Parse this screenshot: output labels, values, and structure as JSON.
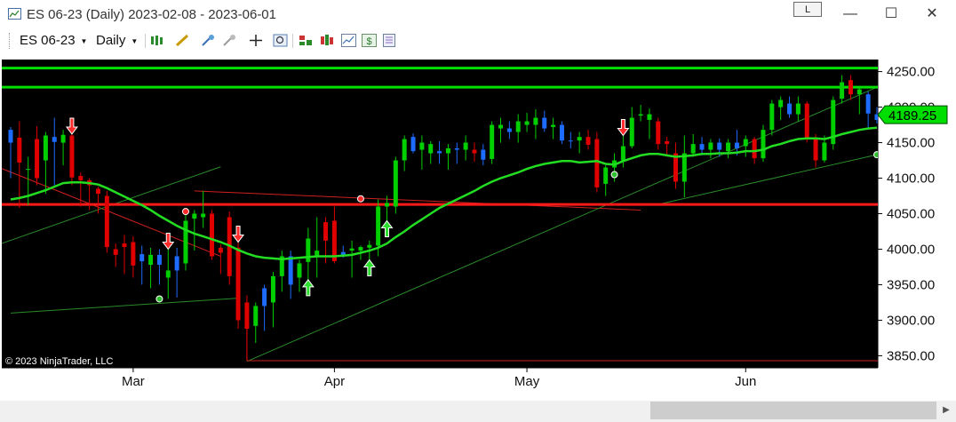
{
  "window": {
    "title": "ES 06-23 (Daily)  2023-02-08 - 2023-06-01",
    "link_button": "L",
    "minimize": "—",
    "maximize": "☐",
    "close": "✕"
  },
  "toolbar": {
    "instrument": "ES 06-23",
    "interval": "Daily",
    "icons": [
      "bar-style-icon",
      "drawing-tool-icon",
      "add-indicator-icon",
      "remove-indicator-icon",
      "crosshair-icon",
      "zoom-icon",
      "strategies-icon",
      "chart-trader-icon",
      "data-series-icon",
      "properties-icon"
    ]
  },
  "colors": {
    "background": "#000000",
    "up_candle": "#00d000",
    "down_candle": "#e00000",
    "blue_candle": "#1e6bff",
    "sma": "#22dd22",
    "horizontal_support": "#ff1a1a",
    "horizontal_resistance": "#00e000",
    "trend_green": "#2a8a2a",
    "trend_red": "#d02020",
    "price_marker": "#00dd00"
  },
  "chart_data": {
    "type": "candlestick",
    "instrument": "ES 06-23",
    "interval": "Daily",
    "x_range": [
      "2023-02-08",
      "2023-06-01"
    ],
    "x_tick_labels": [
      "Mar",
      "Apr",
      "May",
      "Jun"
    ],
    "y_tick_labels": [
      "4250.00",
      "4200.00",
      "4150.00",
      "4100.00",
      "4050.00",
      "4000.00",
      "3950.00",
      "3900.00",
      "3850.00"
    ],
    "ylim": [
      3833,
      4267
    ],
    "last_price": "4189.25",
    "copyright": "© 2023 NinjaTrader, LLC",
    "horizontal_lines": [
      {
        "price": 4255,
        "color": "green"
      },
      {
        "price": 4228,
        "color": "green"
      },
      {
        "price": 4063,
        "color": "red"
      }
    ],
    "candles": [
      {
        "o": 4150,
        "h": 4172,
        "l": 4100,
        "c": 4168,
        "k": "b"
      },
      {
        "o": 4157,
        "h": 4180,
        "l": 4058,
        "c": 4122,
        "k": "d"
      },
      {
        "o": 4113,
        "h": 4130,
        "l": 4062,
        "c": 4113,
        "k": "u"
      },
      {
        "o": 4100,
        "h": 4173,
        "l": 4090,
        "c": 4155,
        "k": "d"
      },
      {
        "o": 4125,
        "h": 4165,
        "l": 4078,
        "c": 4160,
        "k": "u"
      },
      {
        "o": 4158,
        "h": 4185,
        "l": 4090,
        "c": 4151,
        "k": "b"
      },
      {
        "o": 4150,
        "h": 4168,
        "l": 4118,
        "c": 4161,
        "k": "u"
      },
      {
        "o": 4160,
        "h": 4162,
        "l": 4090,
        "c": 4101,
        "k": "d"
      },
      {
        "o": 4103,
        "h": 4108,
        "l": 4060,
        "c": 4097,
        "k": "d"
      },
      {
        "o": 4097,
        "h": 4100,
        "l": 4055,
        "c": 4090,
        "k": "d"
      },
      {
        "o": 4085,
        "h": 4088,
        "l": 4050,
        "c": 4078,
        "k": "d"
      },
      {
        "o": 4075,
        "h": 4082,
        "l": 3995,
        "c": 4003,
        "k": "d"
      },
      {
        "o": 4000,
        "h": 4008,
        "l": 3975,
        "c": 3992,
        "k": "d"
      },
      {
        "o": 4008,
        "h": 4020,
        "l": 3965,
        "c": 4003,
        "k": "d"
      },
      {
        "o": 4010,
        "h": 4018,
        "l": 3960,
        "c": 3977,
        "k": "d"
      },
      {
        "o": 3983,
        "h": 4005,
        "l": 3950,
        "c": 3993,
        "k": "b"
      },
      {
        "o": 3978,
        "h": 4002,
        "l": 3945,
        "c": 3992,
        "k": "u"
      },
      {
        "o": 3992,
        "h": 4000,
        "l": 3950,
        "c": 3978,
        "k": "b"
      },
      {
        "o": 3970,
        "h": 4000,
        "l": 3930,
        "c": 3960,
        "k": "u"
      },
      {
        "o": 3970,
        "h": 4002,
        "l": 3932,
        "c": 3990,
        "k": "b"
      },
      {
        "o": 3980,
        "h": 4052,
        "l": 3970,
        "c": 4040,
        "k": "u"
      },
      {
        "o": 4043,
        "h": 4055,
        "l": 3998,
        "c": 4050,
        "k": "u"
      },
      {
        "o": 4045,
        "h": 4082,
        "l": 4030,
        "c": 4050,
        "k": "u"
      },
      {
        "o": 4050,
        "h": 4055,
        "l": 3985,
        "c": 3990,
        "k": "d"
      },
      {
        "o": 4002,
        "h": 4007,
        "l": 3965,
        "c": 3995,
        "k": "d"
      },
      {
        "o": 4045,
        "h": 4053,
        "l": 3950,
        "c": 3962,
        "k": "d"
      },
      {
        "o": 4002,
        "h": 4010,
        "l": 3888,
        "c": 3900,
        "k": "d"
      },
      {
        "o": 3925,
        "h": 3935,
        "l": 3843,
        "c": 3888,
        "k": "d"
      },
      {
        "o": 3892,
        "h": 3925,
        "l": 3868,
        "c": 3920,
        "k": "u"
      },
      {
        "o": 3920,
        "h": 3950,
        "l": 3885,
        "c": 3945,
        "k": "b"
      },
      {
        "o": 3925,
        "h": 3968,
        "l": 3890,
        "c": 3962,
        "k": "u"
      },
      {
        "o": 3962,
        "h": 3998,
        "l": 3940,
        "c": 3990,
        "k": "u"
      },
      {
        "o": 3990,
        "h": 3998,
        "l": 3930,
        "c": 3950,
        "k": "b"
      },
      {
        "o": 3960,
        "h": 3985,
        "l": 3940,
        "c": 3980,
        "k": "u"
      },
      {
        "o": 3982,
        "h": 4030,
        "l": 3957,
        "c": 4015,
        "k": "u"
      },
      {
        "o": 3990,
        "h": 4045,
        "l": 3960,
        "c": 3998,
        "k": "u"
      },
      {
        "o": 4038,
        "h": 4045,
        "l": 3980,
        "c": 4012,
        "k": "d"
      },
      {
        "o": 4040,
        "h": 4060,
        "l": 3980,
        "c": 3983,
        "k": "d"
      },
      {
        "o": 3992,
        "h": 4005,
        "l": 3988,
        "c": 3996,
        "k": "b"
      },
      {
        "o": 3998,
        "h": 4012,
        "l": 3960,
        "c": 4001,
        "k": "u"
      },
      {
        "o": 3998,
        "h": 4005,
        "l": 3985,
        "c": 4003,
        "k": "u"
      },
      {
        "o": 4002,
        "h": 4012,
        "l": 3985,
        "c": 4006,
        "k": "u"
      },
      {
        "o": 4005,
        "h": 4070,
        "l": 3990,
        "c": 4060,
        "k": "u"
      },
      {
        "o": 4060,
        "h": 4075,
        "l": 4040,
        "c": 4065,
        "k": "u"
      },
      {
        "o": 4060,
        "h": 4130,
        "l": 4050,
        "c": 4125,
        "k": "u"
      },
      {
        "o": 4125,
        "h": 4160,
        "l": 4110,
        "c": 4155,
        "k": "u"
      },
      {
        "o": 4158,
        "h": 4163,
        "l": 4135,
        "c": 4138,
        "k": "b"
      },
      {
        "o": 4140,
        "h": 4160,
        "l": 4112,
        "c": 4150,
        "k": "u"
      },
      {
        "o": 4148,
        "h": 4152,
        "l": 4120,
        "c": 4135,
        "k": "u"
      },
      {
        "o": 4138,
        "h": 4152,
        "l": 4120,
        "c": 4135,
        "k": "b"
      },
      {
        "o": 4135,
        "h": 4148,
        "l": 4112,
        "c": 4142,
        "k": "u"
      },
      {
        "o": 4142,
        "h": 4150,
        "l": 4120,
        "c": 4140,
        "k": "b"
      },
      {
        "o": 4140,
        "h": 4160,
        "l": 4125,
        "c": 4150,
        "k": "u"
      },
      {
        "o": 4140,
        "h": 4150,
        "l": 4123,
        "c": 4135,
        "k": "d"
      },
      {
        "o": 4140,
        "h": 4148,
        "l": 4118,
        "c": 4126,
        "k": "b"
      },
      {
        "o": 4127,
        "h": 4180,
        "l": 4120,
        "c": 4175,
        "k": "u"
      },
      {
        "o": 4175,
        "h": 4185,
        "l": 4150,
        "c": 4170,
        "k": "u"
      },
      {
        "o": 4170,
        "h": 4180,
        "l": 4155,
        "c": 4165,
        "k": "b"
      },
      {
        "o": 4165,
        "h": 4190,
        "l": 4150,
        "c": 4180,
        "k": "u"
      },
      {
        "o": 4180,
        "h": 4192,
        "l": 4165,
        "c": 4175,
        "k": "u"
      },
      {
        "o": 4175,
        "h": 4197,
        "l": 4155,
        "c": 4185,
        "k": "u"
      },
      {
        "o": 4185,
        "h": 4195,
        "l": 4165,
        "c": 4170,
        "k": "b"
      },
      {
        "o": 4172,
        "h": 4185,
        "l": 4155,
        "c": 4175,
        "k": "u"
      },
      {
        "o": 4175,
        "h": 4180,
        "l": 4148,
        "c": 4153,
        "k": "b"
      },
      {
        "o": 4153,
        "h": 4165,
        "l": 4142,
        "c": 4153,
        "k": "b"
      },
      {
        "o": 4153,
        "h": 4165,
        "l": 4135,
        "c": 4158,
        "k": "u"
      },
      {
        "o": 4158,
        "h": 4168,
        "l": 4140,
        "c": 4147,
        "k": "d"
      },
      {
        "o": 4155,
        "h": 4165,
        "l": 4080,
        "c": 4087,
        "k": "d"
      },
      {
        "o": 4092,
        "h": 4118,
        "l": 4075,
        "c": 4115,
        "k": "u"
      },
      {
        "o": 4115,
        "h": 4135,
        "l": 4095,
        "c": 4125,
        "k": "u"
      },
      {
        "o": 4125,
        "h": 4160,
        "l": 4115,
        "c": 4145,
        "k": "u"
      },
      {
        "o": 4145,
        "h": 4200,
        "l": 4142,
        "c": 4185,
        "k": "u"
      },
      {
        "o": 4188,
        "h": 4203,
        "l": 4180,
        "c": 4190,
        "k": "u"
      },
      {
        "o": 4190,
        "h": 4198,
        "l": 4155,
        "c": 4182,
        "k": "u"
      },
      {
        "o": 4180,
        "h": 4185,
        "l": 4140,
        "c": 4148,
        "k": "d"
      },
      {
        "o": 4148,
        "h": 4158,
        "l": 4130,
        "c": 4152,
        "k": "d"
      },
      {
        "o": 4135,
        "h": 4150,
        "l": 4085,
        "c": 4095,
        "k": "d"
      },
      {
        "o": 4095,
        "h": 4160,
        "l": 4073,
        "c": 4135,
        "k": "u"
      },
      {
        "o": 4135,
        "h": 4162,
        "l": 4130,
        "c": 4148,
        "k": "u"
      },
      {
        "o": 4148,
        "h": 4158,
        "l": 4132,
        "c": 4140,
        "k": "b"
      },
      {
        "o": 4140,
        "h": 4155,
        "l": 4128,
        "c": 4150,
        "k": "u"
      },
      {
        "o": 4150,
        "h": 4156,
        "l": 4130,
        "c": 4140,
        "k": "b"
      },
      {
        "o": 4138,
        "h": 4155,
        "l": 4128,
        "c": 4150,
        "k": "u"
      },
      {
        "o": 4150,
        "h": 4168,
        "l": 4132,
        "c": 4142,
        "k": "b"
      },
      {
        "o": 4145,
        "h": 4160,
        "l": 4130,
        "c": 4155,
        "k": "u"
      },
      {
        "o": 4155,
        "h": 4158,
        "l": 4120,
        "c": 4128,
        "k": "d"
      },
      {
        "o": 4128,
        "h": 4175,
        "l": 4123,
        "c": 4168,
        "k": "u"
      },
      {
        "o": 4168,
        "h": 4210,
        "l": 4160,
        "c": 4205,
        "k": "u"
      },
      {
        "o": 4200,
        "h": 4215,
        "l": 4182,
        "c": 4210,
        "k": "u"
      },
      {
        "o": 4205,
        "h": 4215,
        "l": 4185,
        "c": 4190,
        "k": "b"
      },
      {
        "o": 4190,
        "h": 4215,
        "l": 4180,
        "c": 4205,
        "k": "u"
      },
      {
        "o": 4205,
        "h": 4208,
        "l": 4150,
        "c": 4155,
        "k": "d"
      },
      {
        "o": 4155,
        "h": 4162,
        "l": 4115,
        "c": 4125,
        "k": "d"
      },
      {
        "o": 4125,
        "h": 4160,
        "l": 4122,
        "c": 4150,
        "k": "u"
      },
      {
        "o": 4148,
        "h": 4215,
        "l": 4140,
        "c": 4210,
        "k": "u"
      },
      {
        "o": 4212,
        "h": 4245,
        "l": 4205,
        "c": 4235,
        "k": "u"
      },
      {
        "o": 4238,
        "h": 4245,
        "l": 4210,
        "c": 4218,
        "k": "d"
      },
      {
        "o": 4218,
        "h": 4230,
        "l": 4190,
        "c": 4225,
        "k": "u"
      },
      {
        "o": 4218,
        "h": 4222,
        "l": 4170,
        "c": 4191,
        "k": "b"
      },
      {
        "o": 4190,
        "h": 4200,
        "l": 4177,
        "c": 4182,
        "k": "b"
      }
    ],
    "sma": [
      4070,
      4072,
      4075,
      4079,
      4083,
      4088,
      4093,
      4094,
      4094,
      4093,
      4091,
      4086,
      4080,
      4074,
      4068,
      4062,
      4055,
      4047,
      4040,
      4033,
      4027,
      4022,
      4018,
      4014,
      4010,
      4005,
      3999,
      3994,
      3990,
      3988,
      3987,
      3986,
      3987,
      3988,
      3989,
      3990,
      3990,
      3990,
      3991,
      3992,
      3995,
      3998,
      4002,
      4008,
      4017,
      4025,
      4034,
      4042,
      4050,
      4058,
      4064,
      4070,
      4076,
      4082,
      4089,
      4095,
      4100,
      4104,
      4108,
      4113,
      4117,
      4120,
      4122,
      4124,
      4124,
      4122,
      4123,
      4124,
      4120,
      4119,
      4124,
      4128,
      4132,
      4134,
      4134,
      4132,
      4130,
      4131,
      4132,
      4134,
      4134,
      4135,
      4135,
      4136,
      4138,
      4138,
      4140,
      4145,
      4148,
      4152,
      4155,
      4156,
      4156,
      4155,
      4158,
      4162,
      4165,
      4168,
      4170,
      4171
    ],
    "signals": [
      {
        "i": 7,
        "type": "sell"
      },
      {
        "i": 18,
        "type": "sell"
      },
      {
        "i": 26,
        "type": "sell"
      },
      {
        "i": 34,
        "type": "buy"
      },
      {
        "i": 41,
        "type": "buy"
      },
      {
        "i": 43,
        "type": "buy"
      },
      {
        "i": 70,
        "type": "sell"
      }
    ],
    "markers": [
      {
        "i": 20,
        "price": 4053,
        "color": "red"
      },
      {
        "i": 17,
        "price": 3930,
        "color": "green"
      },
      {
        "i": 40,
        "price": 4071,
        "color": "red"
      },
      {
        "i": 69,
        "price": 4105,
        "color": "green"
      },
      {
        "i": 99,
        "price": 4133,
        "color": "green"
      }
    ]
  }
}
